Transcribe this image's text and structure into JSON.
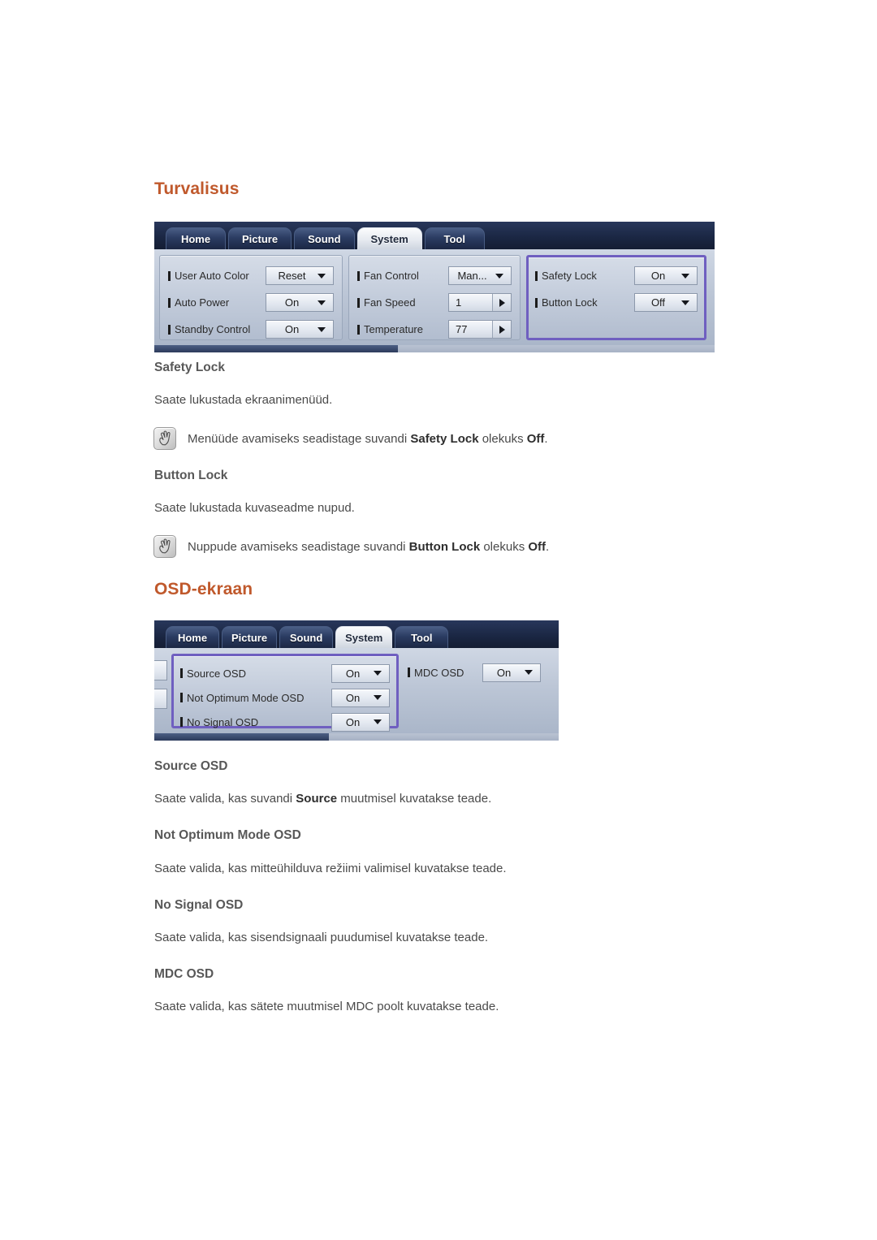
{
  "sections": [
    {
      "heading": "Turvalisus",
      "osd": {
        "tabs": [
          {
            "label": "Home",
            "active": false
          },
          {
            "label": "Picture",
            "active": false
          },
          {
            "label": "Sound",
            "active": false
          },
          {
            "label": "System",
            "active": true
          },
          {
            "label": "Tool",
            "active": false
          }
        ],
        "groups": [
          {
            "highlight": false,
            "rows": [
              {
                "label": "User Auto Color",
                "value": "Reset",
                "control": "dropdown"
              },
              {
                "label": "Auto Power",
                "value": "On",
                "control": "dropdown"
              },
              {
                "label": "Standby Control",
                "value": "On",
                "control": "dropdown"
              }
            ]
          },
          {
            "highlight": false,
            "rows": [
              {
                "label": "Fan Control",
                "value": "Man...",
                "control": "dropdown"
              },
              {
                "label": "Fan Speed",
                "value": "1",
                "control": "spinner"
              },
              {
                "label": "Temperature",
                "value": "77",
                "control": "spinner"
              }
            ]
          },
          {
            "highlight": true,
            "rows": [
              {
                "label": "Safety Lock",
                "value": "On",
                "control": "dropdown"
              },
              {
                "label": "Button Lock",
                "value": "Off",
                "control": "dropdown"
              }
            ]
          }
        ]
      },
      "items": [
        {
          "title": "Safety Lock",
          "desc_plain": "Saate lukustada ekraanimenüüd.",
          "note": {
            "pre": "Menüüde avamiseks seadistage suvandi ",
            "bold1": "Safety Lock",
            "mid": " olekuks ",
            "bold2": "Off",
            "post": "."
          }
        },
        {
          "title": "Button Lock",
          "desc_plain": "Saate lukustada kuvaseadme nupud.",
          "note": {
            "pre": "Nuppude avamiseks seadistage suvandi ",
            "bold1": "Button Lock",
            "mid": " olekuks ",
            "bold2": "Off",
            "post": "."
          }
        }
      ]
    },
    {
      "heading": "OSD-ekraan",
      "osd": {
        "tabs": [
          {
            "label": "Home",
            "active": false
          },
          {
            "label": "Picture",
            "active": false
          },
          {
            "label": "Sound",
            "active": false
          },
          {
            "label": "System",
            "active": true
          },
          {
            "label": "Tool",
            "active": false
          }
        ],
        "groups": [
          {
            "highlight": true,
            "rows": [
              {
                "label": "Source OSD",
                "value": "On",
                "control": "dropdown"
              },
              {
                "label": "Not Optimum Mode OSD",
                "value": "On",
                "control": "dropdown"
              },
              {
                "label": "No Signal OSD",
                "value": "On",
                "control": "dropdown"
              }
            ]
          },
          {
            "highlight": false,
            "rows": [
              {
                "label": "MDC OSD",
                "value": "On",
                "control": "dropdown"
              }
            ]
          }
        ]
      },
      "items": [
        {
          "title": "Source OSD",
          "desc_pre": "Saate valida, kas suvandi ",
          "desc_bold": "Source",
          "desc_post": " muutmisel kuvatakse teade."
        },
        {
          "title": "Not Optimum Mode OSD",
          "desc_plain": "Saate valida, kas mitteühilduva režiimi valimisel kuvatakse teade."
        },
        {
          "title": "No Signal OSD",
          "desc_plain": "Saate valida, kas sisendsignaali puudumisel kuvatakse teade."
        },
        {
          "title": "MDC OSD",
          "desc_plain": "Saate valida, kas sätete muutmisel MDC poolt kuvatakse teade."
        }
      ]
    }
  ],
  "colors": {
    "heading": "#c0592c",
    "sub_heading": "#585858",
    "body": "#4a4a4a",
    "osd_highlight": "#6f5fc0",
    "osd_tabbar": "#1d2a47"
  },
  "icons": {
    "note": "note-hand-icon",
    "dropdown": "chevron-down-icon",
    "spinner": "chevron-right-icon"
  }
}
